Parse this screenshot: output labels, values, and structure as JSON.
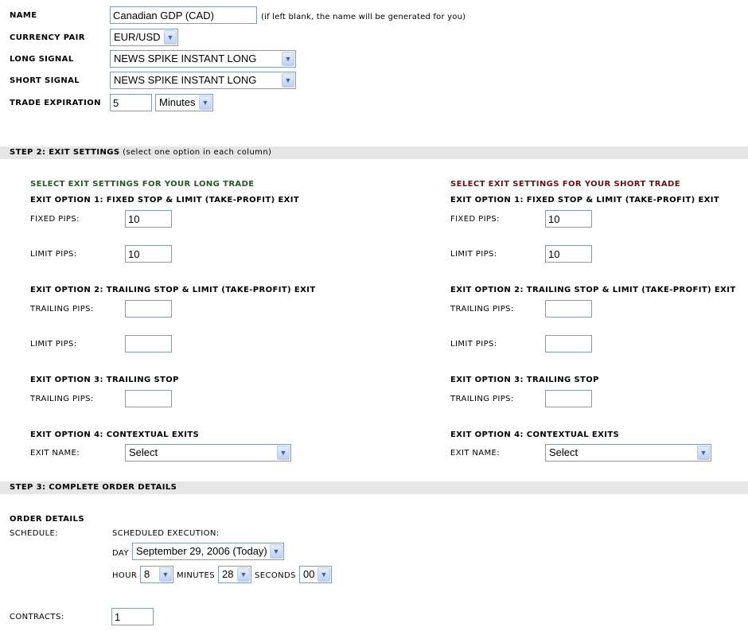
{
  "step1": {
    "name_label": "Name",
    "name_value": "Canadian GDP (CAD)",
    "name_hint": "(if left blank, the name will be generated for you)",
    "currency_label": "Currency Pair",
    "currency_value": "EUR/USD",
    "long_signal_label": "Long Signal",
    "long_signal_value": "NEWS SPIKE INSTANT LONG",
    "short_signal_label": "Short Signal",
    "short_signal_value": "NEWS SPIKE INSTANT LONG",
    "expiration_label": "Trade Expiration",
    "expiration_value": "5",
    "expiration_unit": "Minutes"
  },
  "step2": {
    "title": "STEP 2: EXIT SETTINGS",
    "hint": "(select one option in each column)",
    "long": {
      "heading": "Select Exit Settings for your Long Trade",
      "opt1_title": "Exit Option 1: Fixed Stop & Limit (Take-Profit) Exit",
      "fixed_label": "Fixed Pips:",
      "fixed_value": "10",
      "limit1_label": "Limit Pips:",
      "limit1_value": "10",
      "opt2_title": "Exit Option 2: Trailing Stop & Limit (Take-Profit) Exit",
      "trailing2_label": "Trailing Pips:",
      "trailing2_value": "",
      "limit2_label": "Limit Pips:",
      "limit2_value": "",
      "opt3_title": "Exit Option 3: Trailing Stop",
      "trailing3_label": "Trailing Pips:",
      "trailing3_value": "",
      "opt4_title": "Exit Option 4: Contextual Exits",
      "exit_name_label": "Exit Name:",
      "exit_name_value": "Select"
    },
    "short": {
      "heading": "Select Exit Settings for your Short Trade",
      "opt1_title": "Exit Option 1: Fixed Stop & Limit (Take-Profit) Exit",
      "fixed_label": "Fixed Pips:",
      "fixed_value": "10",
      "limit1_label": "Limit Pips:",
      "limit1_value": "10",
      "opt2_title": "Exit Option 2: Trailing Stop & Limit (Take-Profit) Exit",
      "trailing2_label": "Trailing Pips:",
      "trailing2_value": "",
      "limit2_label": "Limit Pips:",
      "limit2_value": "",
      "opt3_title": "Exit Option 3: Trailing Stop",
      "trailing3_label": "Trailing Pips:",
      "trailing3_value": "",
      "opt4_title": "Exit Option 4: Contextual Exits",
      "exit_name_label": "Exit Name:",
      "exit_name_value": "Select"
    }
  },
  "step3": {
    "title": "STEP 3: COMPLETE ORDER DETAILS",
    "order_details_label": "Order Details",
    "schedule_label": "Schedule:",
    "scheduled_execution_label": "Scheduled Execution:",
    "day_label": "Day",
    "day_value": "September 29, 2006 (Today)",
    "hour_label": "Hour",
    "hour_value": "8",
    "minutes_label": "Minutes",
    "minutes_value": "28",
    "seconds_label": "Seconds",
    "seconds_value": "00",
    "contracts_label": "Contracts:",
    "contracts_value": "1"
  },
  "icons": {
    "dropdown": "chevron-down-icon"
  },
  "colors": {
    "band": "#e6e6e6",
    "long_heading": "#1f5c1f",
    "short_heading": "#6b1010",
    "input_border": "#7f9db9"
  }
}
